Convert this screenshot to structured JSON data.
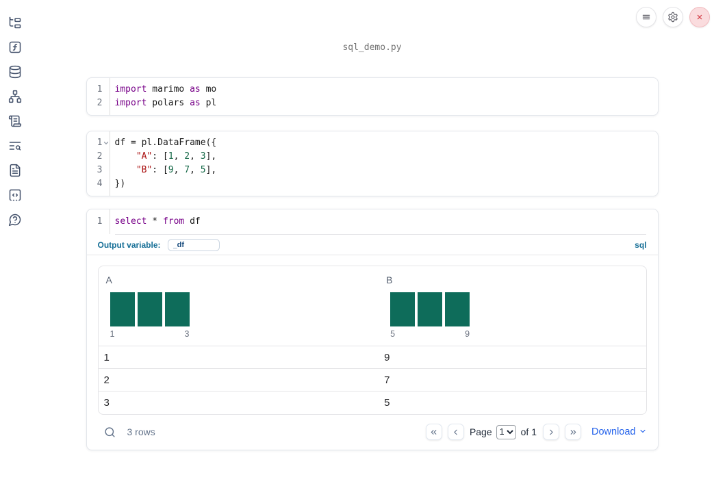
{
  "topbar": {
    "title": "sql_demo.py",
    "buttons": [
      "menu",
      "settings",
      "close"
    ]
  },
  "sidebar": {
    "items": [
      "file-tree",
      "function-square",
      "database",
      "network",
      "scroll-text",
      "list-search",
      "file-text",
      "code-square-dashed",
      "help-message"
    ]
  },
  "colors": {
    "histogram_bar": "#0e6c5a",
    "keyword": "#770088",
    "string": "#aa1111",
    "number": "#116644",
    "label_blue": "#156e96",
    "link_blue": "#2563eb"
  },
  "cells": [
    {
      "name": "imports-cell",
      "lines": [
        {
          "n": "1",
          "tokens": [
            [
              "kw",
              "import"
            ],
            [
              "pl",
              " marimo "
            ],
            [
              "kw",
              "as"
            ],
            [
              "pl",
              " mo"
            ]
          ]
        },
        {
          "n": "2",
          "tokens": [
            [
              "kw",
              "import"
            ],
            [
              "pl",
              " polars "
            ],
            [
              "kw",
              "as"
            ],
            [
              "pl",
              " pl"
            ]
          ]
        }
      ]
    },
    {
      "name": "dataframe-cell",
      "lines": [
        {
          "n": "1",
          "fold": true,
          "tokens": [
            [
              "pl",
              "df = pl.DataFrame({"
            ]
          ]
        },
        {
          "n": "2",
          "tokens": [
            [
              "pl",
              "    "
            ],
            [
              "str",
              "\"A\""
            ],
            [
              "pl",
              ": ["
            ],
            [
              "num",
              "1"
            ],
            [
              "pl",
              ", "
            ],
            [
              "num",
              "2"
            ],
            [
              "pl",
              ", "
            ],
            [
              "num",
              "3"
            ],
            [
              "pl",
              "],"
            ]
          ]
        },
        {
          "n": "3",
          "tokens": [
            [
              "pl",
              "    "
            ],
            [
              "str",
              "\"B\""
            ],
            [
              "pl",
              ": ["
            ],
            [
              "num",
              "9"
            ],
            [
              "pl",
              ", "
            ],
            [
              "num",
              "7"
            ],
            [
              "pl",
              ", "
            ],
            [
              "num",
              "5"
            ],
            [
              "pl",
              "],"
            ]
          ]
        },
        {
          "n": "4",
          "tokens": [
            [
              "pl",
              "})"
            ]
          ]
        }
      ]
    },
    {
      "name": "sql-cell",
      "lines": [
        {
          "n": "1",
          "tokens": [
            [
              "kw",
              "select"
            ],
            [
              "pl",
              " * "
            ],
            [
              "kw",
              "from"
            ],
            [
              "pl",
              " df"
            ]
          ]
        }
      ]
    }
  ],
  "sql_cell": {
    "output_variable_label": "Output variable:",
    "output_variable_value": "_df",
    "language_badge": "sql"
  },
  "table": {
    "columns": [
      {
        "header": "A",
        "histogram": {
          "bars": [
            1,
            1,
            1
          ],
          "min_label": "1",
          "max_label": "3"
        }
      },
      {
        "header": "B",
        "histogram": {
          "bars": [
            1,
            1,
            1
          ],
          "min_label": "5",
          "max_label": "9"
        }
      }
    ],
    "rows": [
      [
        "1",
        "9"
      ],
      [
        "2",
        "7"
      ],
      [
        "3",
        "5"
      ]
    ],
    "footer": {
      "row_count": "3 rows",
      "page_label": "Page",
      "page_value": "1",
      "of_label": "of 1",
      "download_label": "Download"
    }
  }
}
